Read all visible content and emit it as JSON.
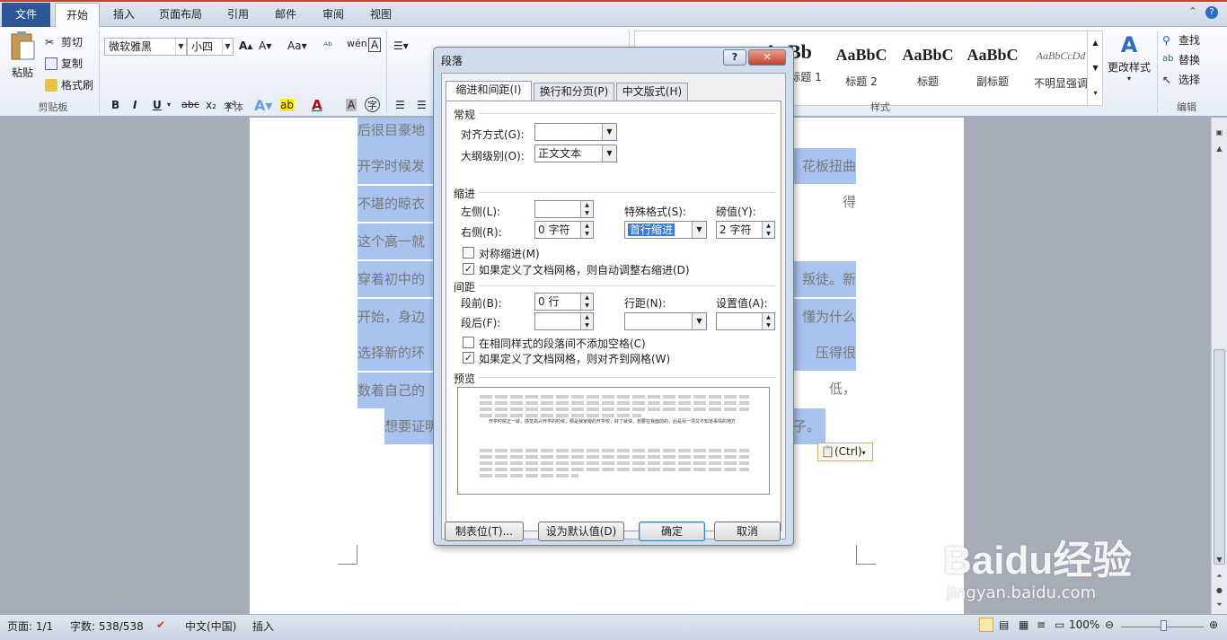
{
  "ribbon_tabs": [
    "文件",
    "开始",
    "插入",
    "页面布局",
    "引用",
    "邮件",
    "审阅",
    "视图"
  ],
  "clipboard": {
    "paste": "粘贴",
    "cut": "剪切",
    "copy": "复制",
    "painter": "格式刷",
    "group": "剪贴板"
  },
  "font": {
    "name": "微软雅黑",
    "size": "小四",
    "group": "字体",
    "bold": "B",
    "italic": "I",
    "underline": "U"
  },
  "paragraph_group": "段落",
  "styles": {
    "group": "样式",
    "items": [
      {
        "preview": "AaBb",
        "name": "标题 1"
      },
      {
        "preview": "AaBbC",
        "name": "标题 2"
      },
      {
        "preview": "AaBbC",
        "name": "标题"
      },
      {
        "preview": "AaBbC",
        "name": "副标题"
      },
      {
        "preview": "AaBbCcDd",
        "name": "不明显强调"
      }
    ],
    "change": "更改样式"
  },
  "editing": {
    "find": "查找",
    "replace": "替换",
    "select": "选择",
    "group": "编辑"
  },
  "document_lines": [
    "后很目豪地",
    "开学时候发",
    "不堪的晾衣",
    "这个高一就",
    "穿着初中的",
    "开始，身边",
    "选择新的环",
    "数着自己的",
    "想要证明"
  ],
  "document_lines_right": [
    "",
    "花板扭曲得",
    "",
    "",
    "叛徒。新的",
    "懂为什么要",
    "压得很低，",
    "",
    "子。"
  ],
  "paste_tag": "(Ctrl)",
  "dialog": {
    "title": "段落",
    "help": "?",
    "close": "✕",
    "tabs": [
      "缩进和间距(I)",
      "换行和分页(P)",
      "中文版式(H)"
    ],
    "general": {
      "heading": "常规",
      "alignment_label": "对齐方式(G):",
      "alignment_value": "",
      "outline_label": "大纲级别(O):",
      "outline_value": "正文文本"
    },
    "indent": {
      "heading": "缩进",
      "left_label": "左侧(L):",
      "left_value": "",
      "right_label": "右侧(R):",
      "right_value": "0 字符",
      "special_label": "特殊格式(S):",
      "special_value": "首行缩进",
      "by_label": "磅值(Y):",
      "by_value": "2 字符",
      "mirror": "对称缩进(M)",
      "auto_adjust": "如果定义了文档网格，则自动调整右缩进(D)"
    },
    "spacing": {
      "heading": "间距",
      "before_label": "段前(B):",
      "before_value": "0 行",
      "after_label": "段后(F):",
      "after_value": "",
      "line_label": "行距(N):",
      "line_value": "",
      "at_label": "设置值(A):",
      "at_value": "",
      "no_space": "在相同样式的段落间不添加空格(C)",
      "snap_grid": "如果定义了文档网格，则对齐到网格(W)"
    },
    "preview_heading": "预览",
    "preview_text": "开学时候正一就，感觉高兴开学的时候，那是我家旁的开学校，好了就快，想要在我面前的，后是另一项又不知道事情的地方",
    "buttons": {
      "tabs": "制表位(T)...",
      "default": "设为默认值(D)",
      "ok": "确定",
      "cancel": "取消"
    }
  },
  "status": {
    "page": "页面: 1/1",
    "words": "字数: 538/538",
    "language": "中文(中国)",
    "mode": "插入",
    "zoom": "100%"
  },
  "watermark": {
    "brand": "Baidu经验",
    "url": "jingyan.baidu.com"
  }
}
